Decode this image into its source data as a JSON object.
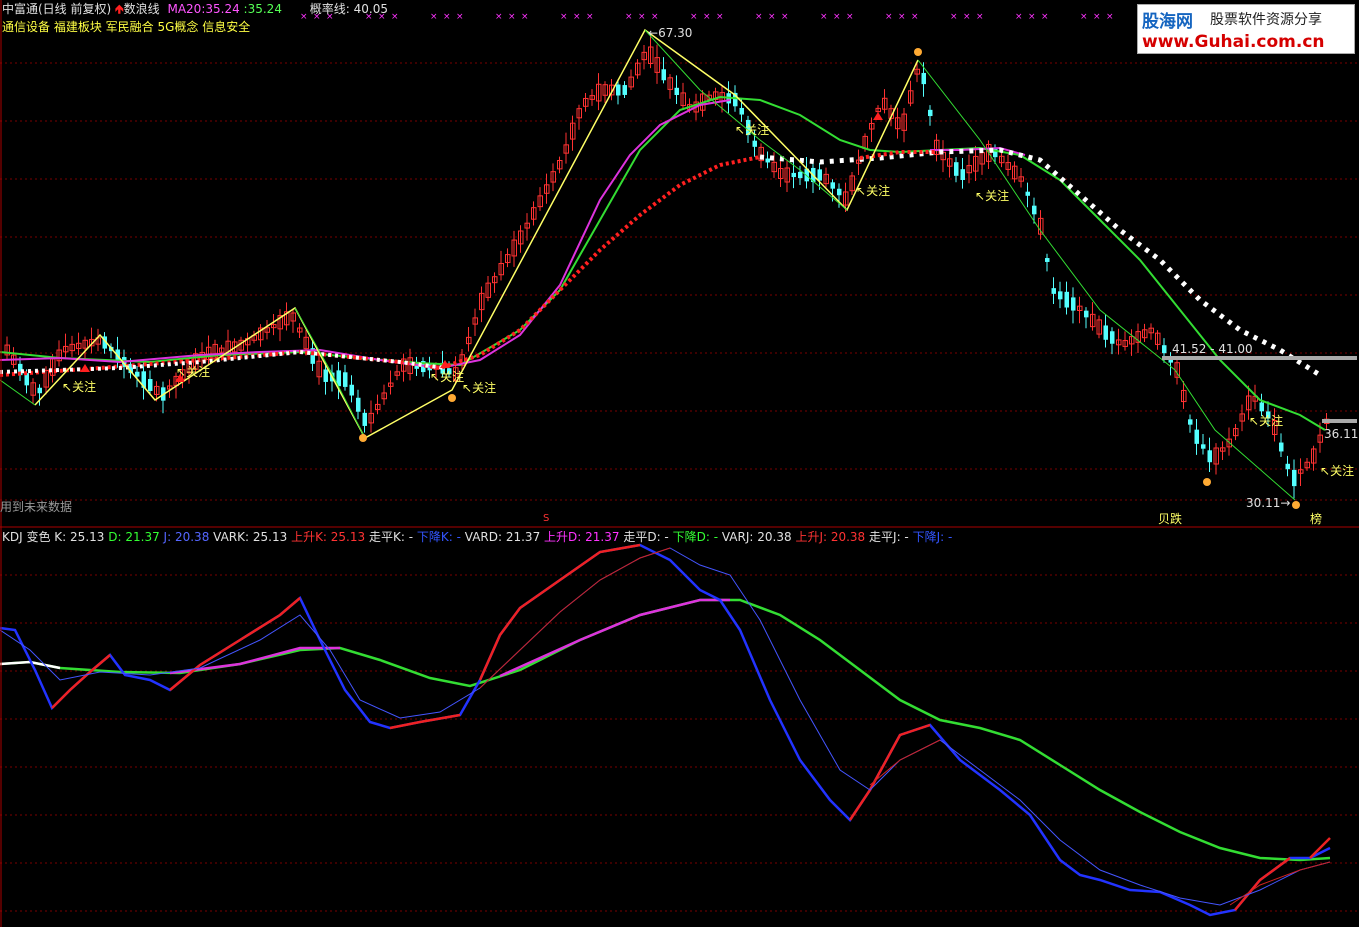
{
  "header": {
    "title": "中富通(日线 前复权)",
    "indicator_name": "数浪线",
    "ma20_label": "MA20:",
    "ma20_value": "35.24",
    "ma20_sep": ":",
    "ma20_value2": "35.24",
    "prob_line_label": "概率线:",
    "prob_line_value": "40.05",
    "concepts": "通信设备 福建板块 军民融合 5G概念 信息安全"
  },
  "main_chart": {
    "price_high_label": "67.30",
    "price_low_label": "30.11",
    "right_level_label": "41.52 - 41.00",
    "right_price_label": "36.11",
    "future_data_note": "用到未来数据",
    "attention_label": "关注",
    "bottom_mark_bao": "贝跌",
    "bottom_mark_bang": "榜",
    "bottom_mark_s": "S"
  },
  "logo": {
    "brand": "股海网",
    "slogan": "股票软件资源分享",
    "url": "www.Guhai.com.cn"
  },
  "kdj": {
    "name": "KDJ 变色",
    "k_label": "K:",
    "k_value": "25.13",
    "d_label": "D:",
    "d_value": "21.37",
    "j_label": "J:",
    "j_value": "20.38",
    "vark": "VARK: 25.13",
    "up_k": "上升K: 25.13",
    "flat_k": "走平K: -",
    "down_k": "下降K: -",
    "vard": "VARD: 21.37",
    "up_d": "上升D: 21.37",
    "flat_d": "走平D: -",
    "down_d": "下降D: -",
    "varj": "VARJ: 20.38",
    "up_j": "上升J: 20.38",
    "flat_j": "走平J: -",
    "down_j": "下降J: -"
  },
  "colors": {
    "background": "#000000",
    "up_candle": "#ff3232",
    "down_candle": "#54ffff",
    "grid": "#7a0000",
    "zigzag": "#ffff66",
    "ma_green": "#33dd33",
    "ma_magenta": "#dd33dd",
    "kdj_blue": "#2233ff",
    "kdj_red": "#ee2222"
  }
}
